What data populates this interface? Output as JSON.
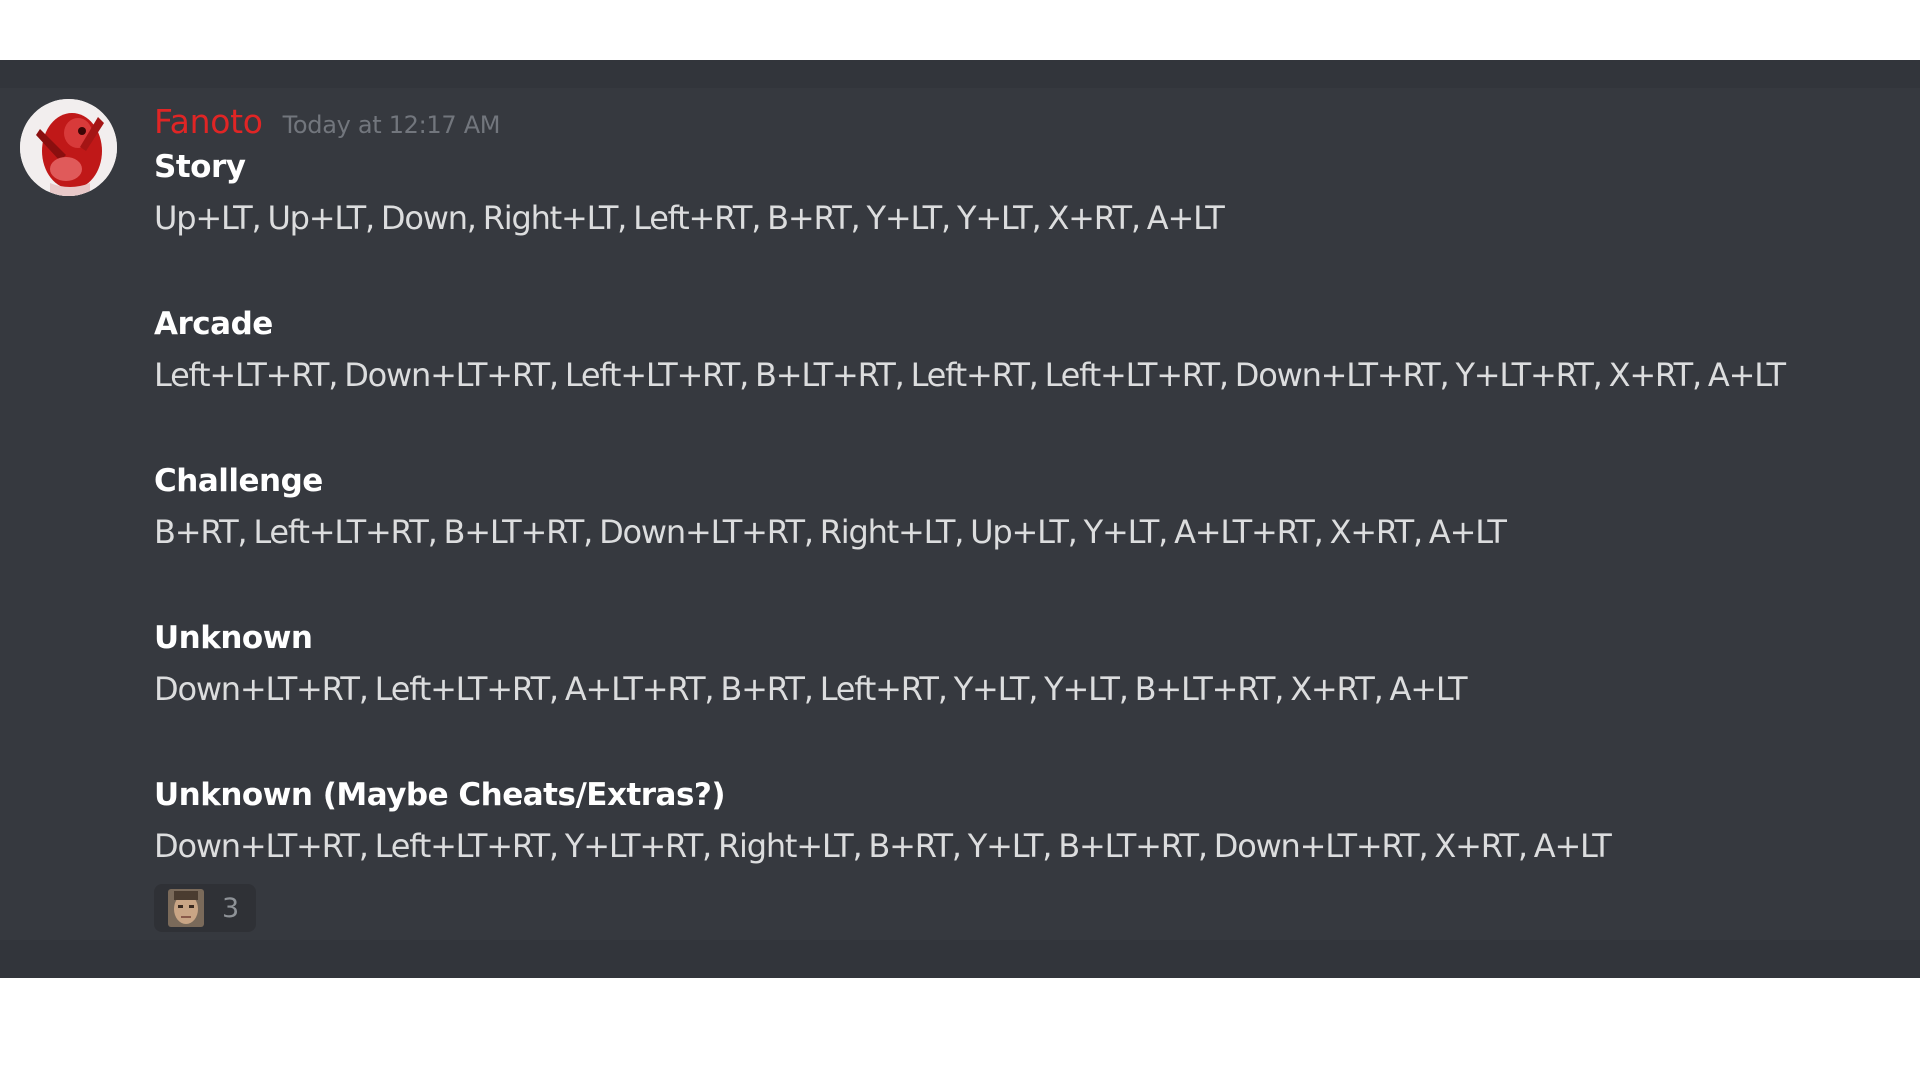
{
  "message": {
    "author": {
      "username": "Fanoto",
      "username_color": "#e02525",
      "avatar_icon": "red-character-avatar"
    },
    "timestamp": "Today at 12:17 AM",
    "sections": [
      {
        "title": "Story",
        "codes": "Up+LT, Up+LT, Down, Right+LT, Left+RT, B+RT, Y+LT, Y+LT, X+RT, A+LT"
      },
      {
        "title": "Arcade",
        "codes": "Left+LT+RT, Down+LT+RT, Left+LT+RT, B+LT+RT, Left+RT, Left+LT+RT, Down+LT+RT, Y+LT+RT, X+RT, A+LT"
      },
      {
        "title": "Challenge",
        "codes": "B+RT, Left+LT+RT, B+LT+RT, Down+LT+RT, Right+LT, Up+LT, Y+LT, A+LT+RT, X+RT, A+LT"
      },
      {
        "title": "Unknown",
        "codes": "Down+LT+RT, Left+LT+RT, A+LT+RT, B+RT, Left+RT, Y+LT, Y+LT, B+LT+RT, X+RT, A+LT"
      },
      {
        "title": "Unknown (Maybe Cheats/Extras?)",
        "codes": "Down+LT+RT, Left+LT+RT, Y+LT+RT, Right+LT, B+RT, Y+LT, B+LT+RT, Down+LT+RT, X+RT, A+LT"
      }
    ],
    "reaction": {
      "emoji_icon": "face-emoji-icon",
      "count": "3"
    }
  },
  "colors": {
    "background": "#36393f",
    "text": "#dcddde",
    "title": "#ffffff",
    "timestamp": "#72767d"
  }
}
